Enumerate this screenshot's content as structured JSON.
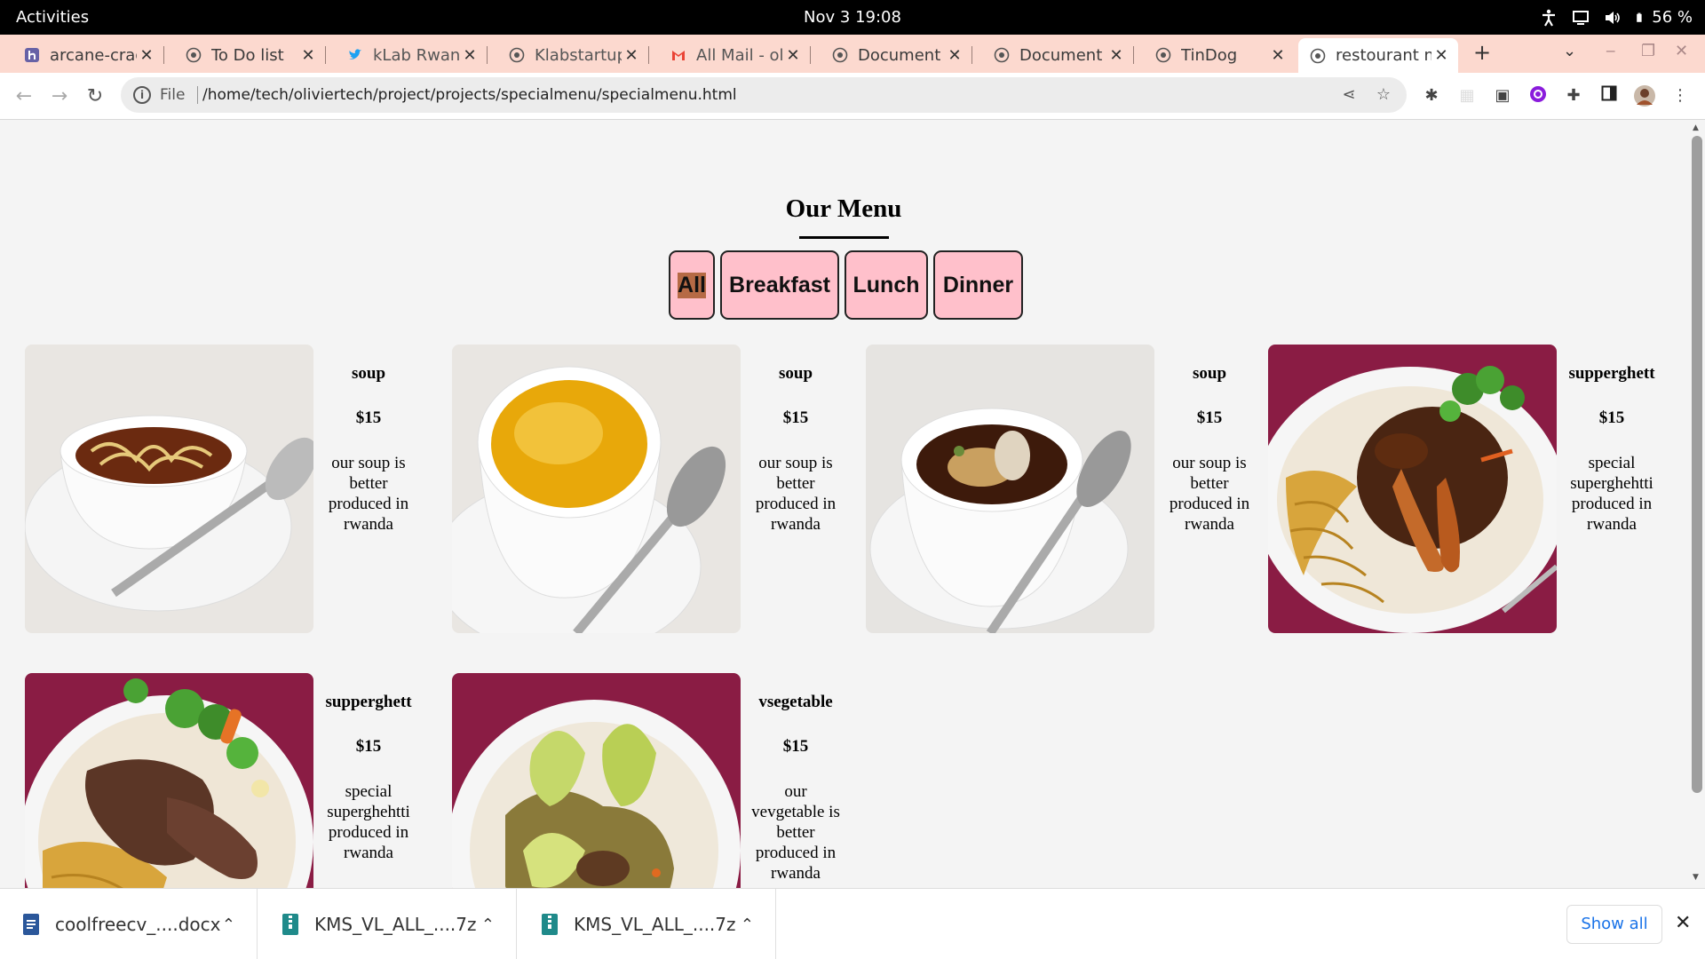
{
  "topbar": {
    "activities": "Activities",
    "clock": "Nov 3  19:08",
    "battery": "56 %"
  },
  "tabs": [
    {
      "title": "arcane-crag",
      "icon": "heroku-icon"
    },
    {
      "title": "To Do list",
      "icon": "globe-icon"
    },
    {
      "title": "kLab Rwand",
      "icon": "twitter-icon"
    },
    {
      "title": "Klabstartup",
      "icon": "globe-icon"
    },
    {
      "title": "All Mail - oli",
      "icon": "gmail-icon"
    },
    {
      "title": "Document",
      "icon": "globe-icon"
    },
    {
      "title": "Document",
      "icon": "globe-icon"
    },
    {
      "title": "TinDog",
      "icon": "globe-icon"
    },
    {
      "title": "restourant n",
      "icon": "globe-icon",
      "active": true
    }
  ],
  "address_bar": {
    "scheme": "File",
    "url": "/home/tech/oliviertech/project/projects/specialmenu/specialmenu.html"
  },
  "page": {
    "title": "Our Menu",
    "filters": [
      "All",
      "Breakfast",
      "Lunch",
      "Dinner"
    ],
    "selected_filter": "All",
    "items": [
      {
        "name": "soup",
        "price": "$15",
        "desc": "our soup is better produced in rwanda",
        "photo": "noodle-soup"
      },
      {
        "name": "soup",
        "price": "$15",
        "desc": "our soup is better produced in rwanda",
        "photo": "egg-drop-soup"
      },
      {
        "name": "soup",
        "price": "$15",
        "desc": "our soup is better produced in rwanda",
        "photo": "wonton-soup"
      },
      {
        "name": "supperghett",
        "price": "$15",
        "desc": "special superghehtti produced in rwanda",
        "photo": "noodles-chicken"
      },
      {
        "name": "supperghett",
        "price": "$15",
        "desc": "special superghehtti produced in rwanda",
        "photo": "noodles-beef"
      },
      {
        "name": "vsegetable",
        "price": "$15",
        "desc": "our vevgetable is better produced in rwanda",
        "photo": "vegetable-beef"
      }
    ]
  },
  "downloads": {
    "files": [
      {
        "name": "coolfreecv_....docx",
        "type": "docx"
      },
      {
        "name": "KMS_VL_ALL_....7z",
        "type": "archive"
      },
      {
        "name": "KMS_VL_ALL_....7z",
        "type": "archive"
      }
    ],
    "show_all": "Show all"
  },
  "colors": {
    "tab_strip": "#fcd9cf",
    "filter_button": "#ffc0cb",
    "filter_selected_highlight": "#b66a45"
  }
}
